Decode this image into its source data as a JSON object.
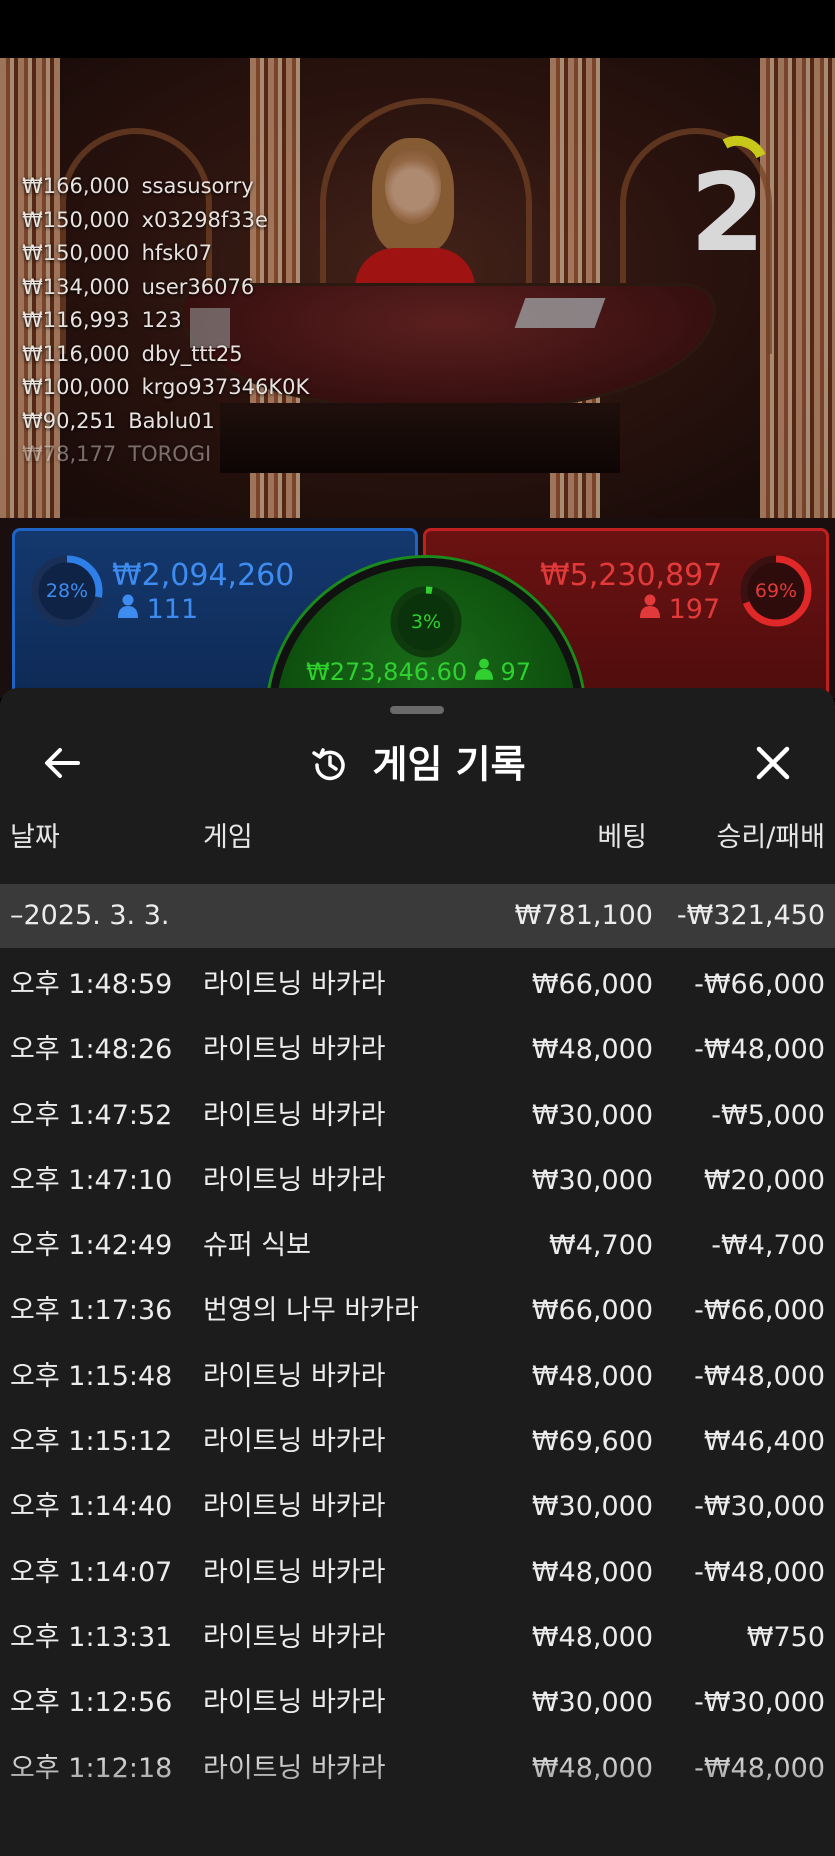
{
  "leaderboard": [
    {
      "amount": "₩166,000",
      "name": "ssasusorry"
    },
    {
      "amount": "₩150,000",
      "name": "x03298f33e"
    },
    {
      "amount": "₩150,000",
      "name": "hfsk07"
    },
    {
      "amount": "₩134,000",
      "name": "user36076"
    },
    {
      "amount": "₩116,993",
      "name": "123"
    },
    {
      "amount": "₩116,000",
      "name": "dby_ttt25"
    },
    {
      "amount": "₩100,000",
      "name": "krgo937346K0K"
    },
    {
      "amount": "₩90,251",
      "name": "Bablu01"
    },
    {
      "amount": "₩78,177",
      "name": "TOROGI"
    }
  ],
  "timer": "2",
  "bets": {
    "player": {
      "percent": "28%",
      "percent_value": 28,
      "amount": "₩2,094,260",
      "count": "111",
      "color": "#2f7fe8"
    },
    "banker": {
      "percent": "69%",
      "percent_value": 69,
      "amount": "₩5,230,897",
      "count": "197",
      "color": "#e02828"
    },
    "tie": {
      "percent": "3%",
      "percent_value": 3,
      "amount": "₩273,846.60",
      "count": "97",
      "color": "#2fd02f"
    }
  },
  "sheet": {
    "title": "게임 기록",
    "columns": {
      "date": "날짜",
      "game": "게임",
      "bet": "베팅",
      "result": "승리/패배"
    },
    "date_row": {
      "date": "–2025. 3. 3.",
      "bet": "₩781,100",
      "result": "-₩321,450"
    },
    "rows": [
      {
        "time": "오후 1:48:59",
        "game": "라이트닝 바카라",
        "bet": "₩66,000",
        "result": "-₩66,000"
      },
      {
        "time": "오후 1:48:26",
        "game": "라이트닝 바카라",
        "bet": "₩48,000",
        "result": "-₩48,000"
      },
      {
        "time": "오후 1:47:52",
        "game": "라이트닝 바카라",
        "bet": "₩30,000",
        "result": "-₩5,000"
      },
      {
        "time": "오후 1:47:10",
        "game": "라이트닝 바카라",
        "bet": "₩30,000",
        "result": "₩20,000"
      },
      {
        "time": "오후 1:42:49",
        "game": "슈퍼 식보",
        "bet": "₩4,700",
        "result": "-₩4,700"
      },
      {
        "time": "오후 1:17:36",
        "game": "번영의 나무 바카라",
        "bet": "₩66,000",
        "result": "-₩66,000"
      },
      {
        "time": "오후 1:15:48",
        "game": "라이트닝 바카라",
        "bet": "₩48,000",
        "result": "-₩48,000"
      },
      {
        "time": "오후 1:15:12",
        "game": "라이트닝 바카라",
        "bet": "₩69,600",
        "result": "₩46,400"
      },
      {
        "time": "오후 1:14:40",
        "game": "라이트닝 바카라",
        "bet": "₩30,000",
        "result": "-₩30,000"
      },
      {
        "time": "오후 1:14:07",
        "game": "라이트닝 바카라",
        "bet": "₩48,000",
        "result": "-₩48,000"
      },
      {
        "time": "오후 1:13:31",
        "game": "라이트닝 바카라",
        "bet": "₩48,000",
        "result": "₩750"
      },
      {
        "time": "오후 1:12:56",
        "game": "라이트닝 바카라",
        "bet": "₩30,000",
        "result": "-₩30,000"
      },
      {
        "time": "오후 1:12:18",
        "game": "라이트닝 바카라",
        "bet": "₩48,000",
        "result": "-₩48,000"
      }
    ]
  },
  "icons": {
    "back": "arrow-left-icon",
    "history": "history-icon",
    "close": "close-icon",
    "user": "user-icon"
  }
}
